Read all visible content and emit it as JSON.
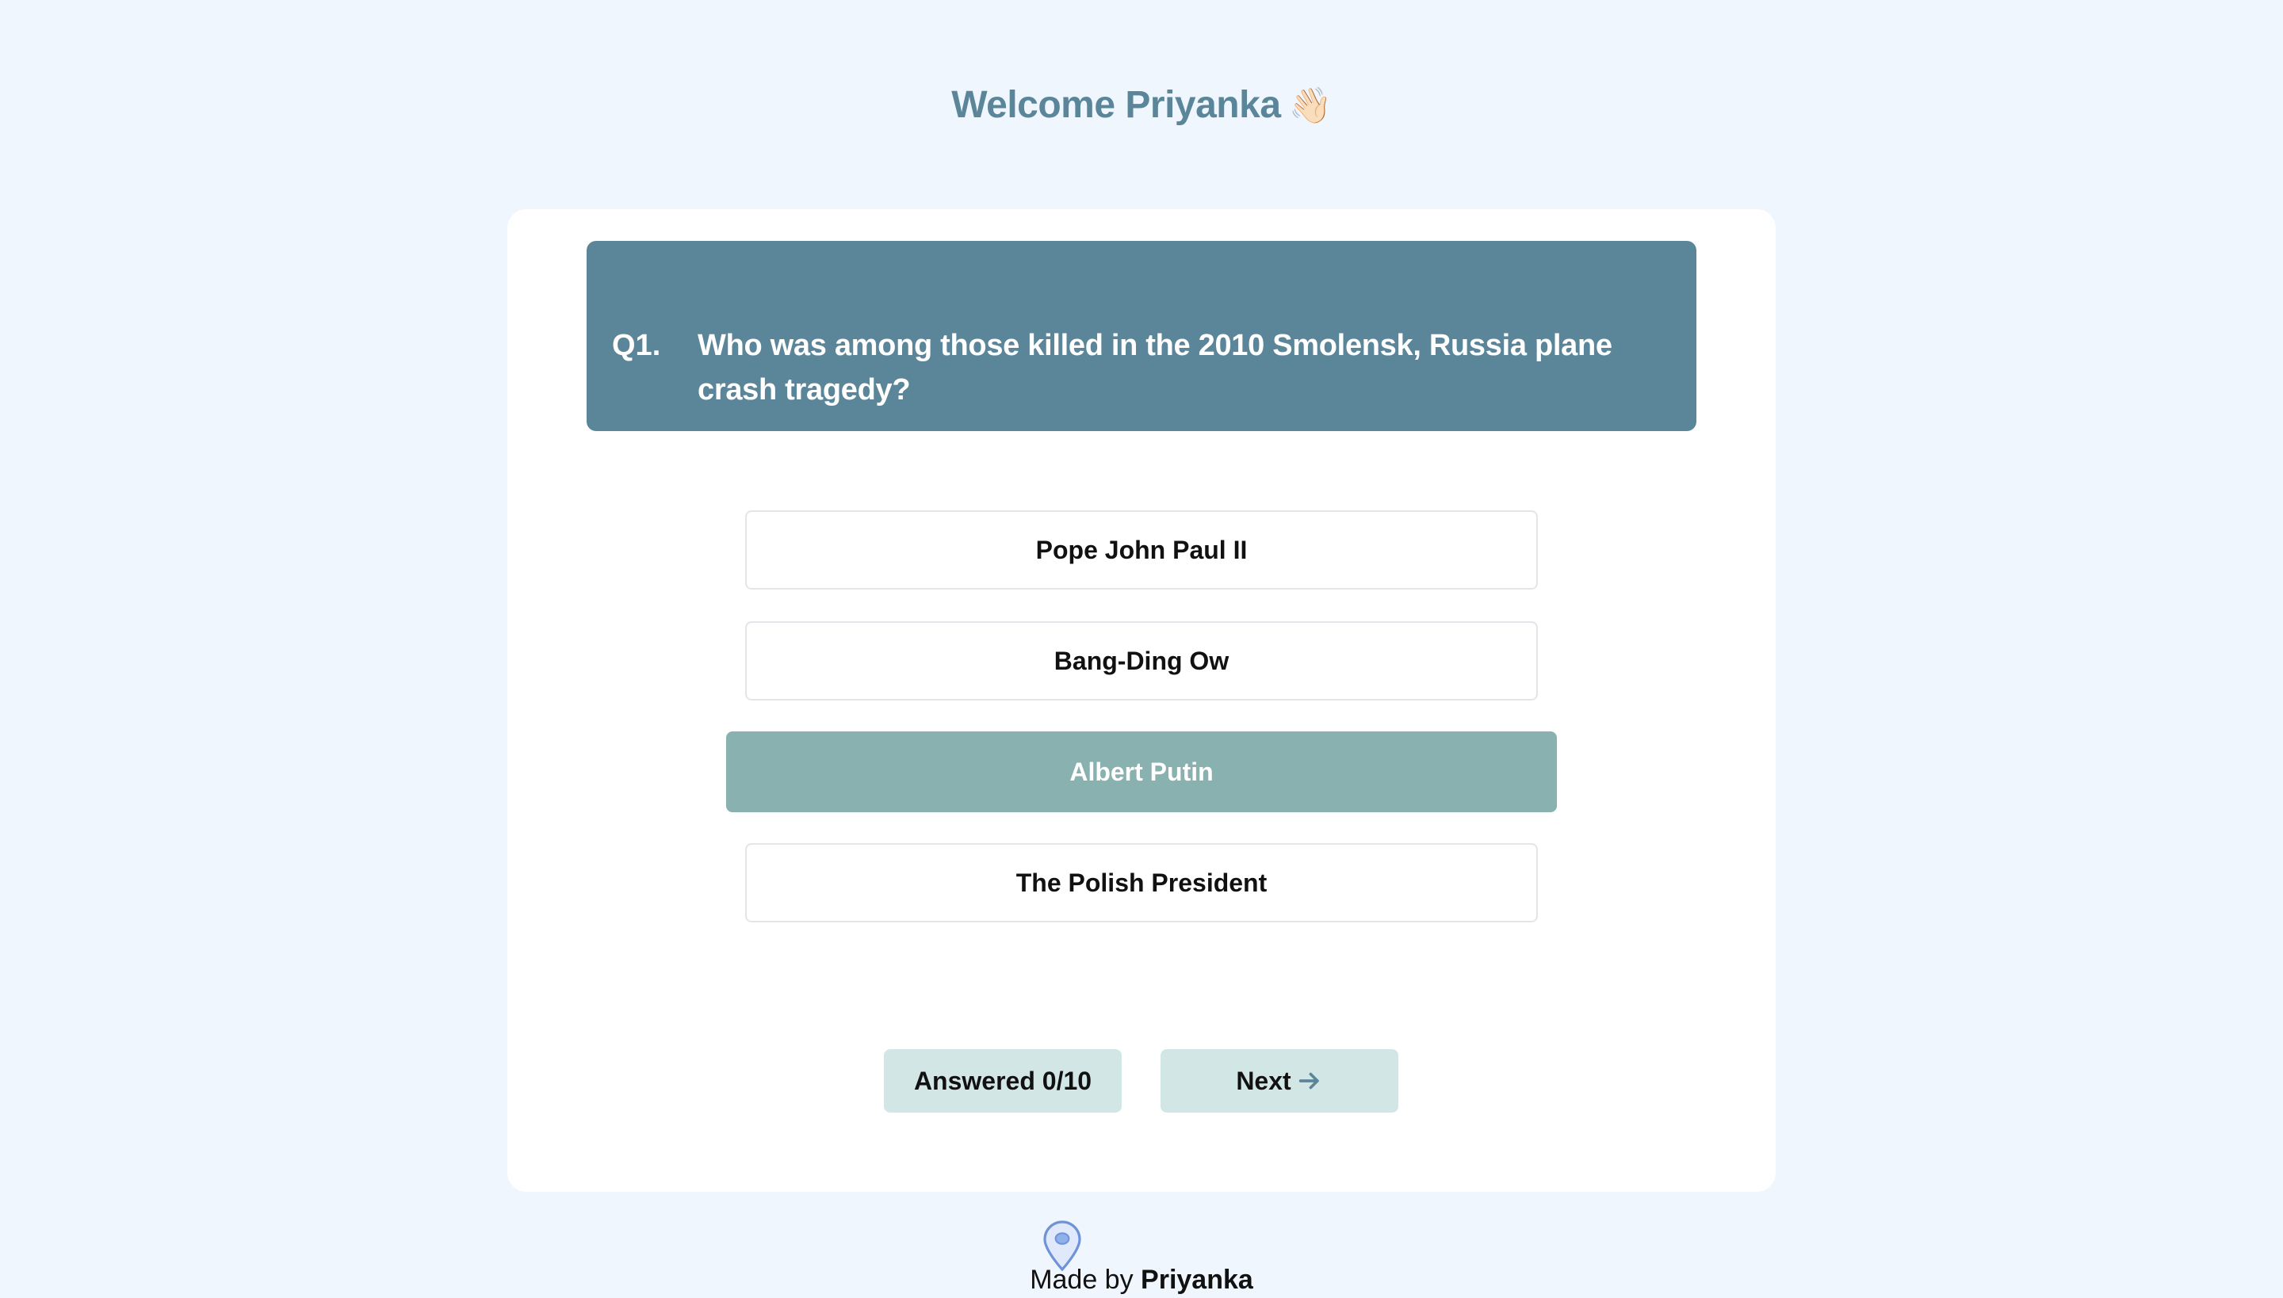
{
  "header": {
    "welcome_text": "Welcome Priyanka",
    "wave_emoji": "👋🏻"
  },
  "quiz": {
    "question_number": "Q1.",
    "question_text": "Who was among those killed in the 2010 Smolensk, Russia plane crash tragedy?",
    "options": [
      {
        "label": "Pope John Paul II",
        "selected": false
      },
      {
        "label": "Bang-Ding Ow",
        "selected": false
      },
      {
        "label": "Albert Putin",
        "selected": true
      },
      {
        "label": "The Polish President",
        "selected": false
      }
    ],
    "answered_label": "Answered 0/10",
    "next_label": "Next"
  },
  "footer": {
    "made_by_prefix": "Made by",
    "author": "Priyanka",
    "pin_icon": "map-pin-icon"
  },
  "colors": {
    "background": "#eff6fe",
    "accent": "#5b869a",
    "selected_option": "#88b1b0",
    "pill_bg": "#d3e6e6"
  }
}
